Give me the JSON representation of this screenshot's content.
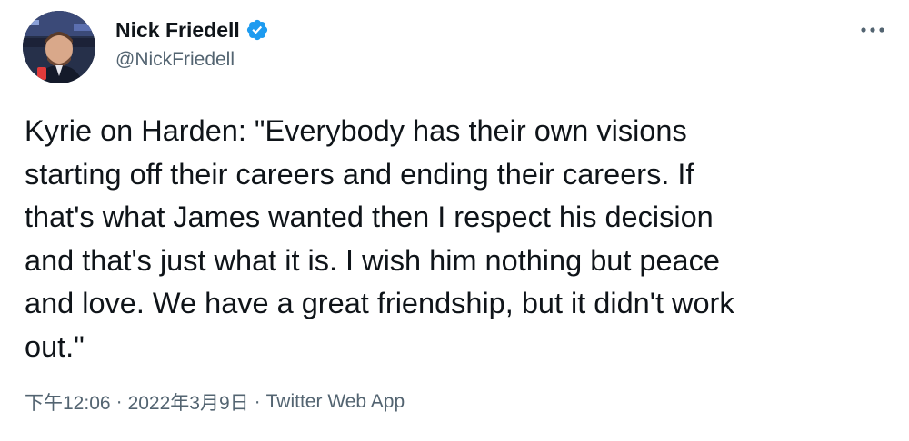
{
  "author": {
    "display_name": "Nick Friedell",
    "handle": "@NickFriedell",
    "verified": true
  },
  "tweet": {
    "lines": [
      "Kyrie on Harden: \"Everybody has their own visions",
      "starting off their careers and ending their careers. If",
      "that's what James wanted then I respect his decision",
      "and that's just what it is. I wish him nothing but peace",
      "and love. We have a great friendship, but it didn't work",
      "out.\""
    ]
  },
  "meta": {
    "time": "下午12:06",
    "separator": "·",
    "date": "2022年3月9日",
    "source": "Twitter Web App"
  },
  "icons": {
    "verified_badge": "verified-badge-icon",
    "more": "more-horizontal-icon"
  },
  "colors": {
    "verified_blue": "#1d9bf0",
    "secondary_text": "#536471",
    "primary_text": "#0f1419"
  }
}
